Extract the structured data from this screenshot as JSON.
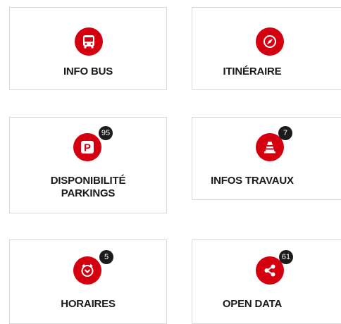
{
  "tiles": {
    "info_bus": {
      "label": "INFO BUS",
      "icon": "bus-icon"
    },
    "itineraire": {
      "label": "ITINÉRAIRE",
      "icon": "compass-icon"
    },
    "parkings": {
      "label_line1": "DISPONIBILITÉ",
      "label_line2": "PARKINGS",
      "icon": "parking-icon",
      "badge": "95"
    },
    "travaux": {
      "label": "INFOS TRAVAUX",
      "icon": "traffic-cone-icon",
      "badge": "7"
    },
    "horaires": {
      "label": "HORAIRES",
      "icon": "clock-icon",
      "badge": "5"
    },
    "open_data": {
      "label": "OPEN DATA",
      "icon": "share-icon",
      "badge": "61"
    }
  },
  "colors": {
    "accent": "#d5000f",
    "badge": "#1c1c1c",
    "border": "#d9d9d9"
  }
}
